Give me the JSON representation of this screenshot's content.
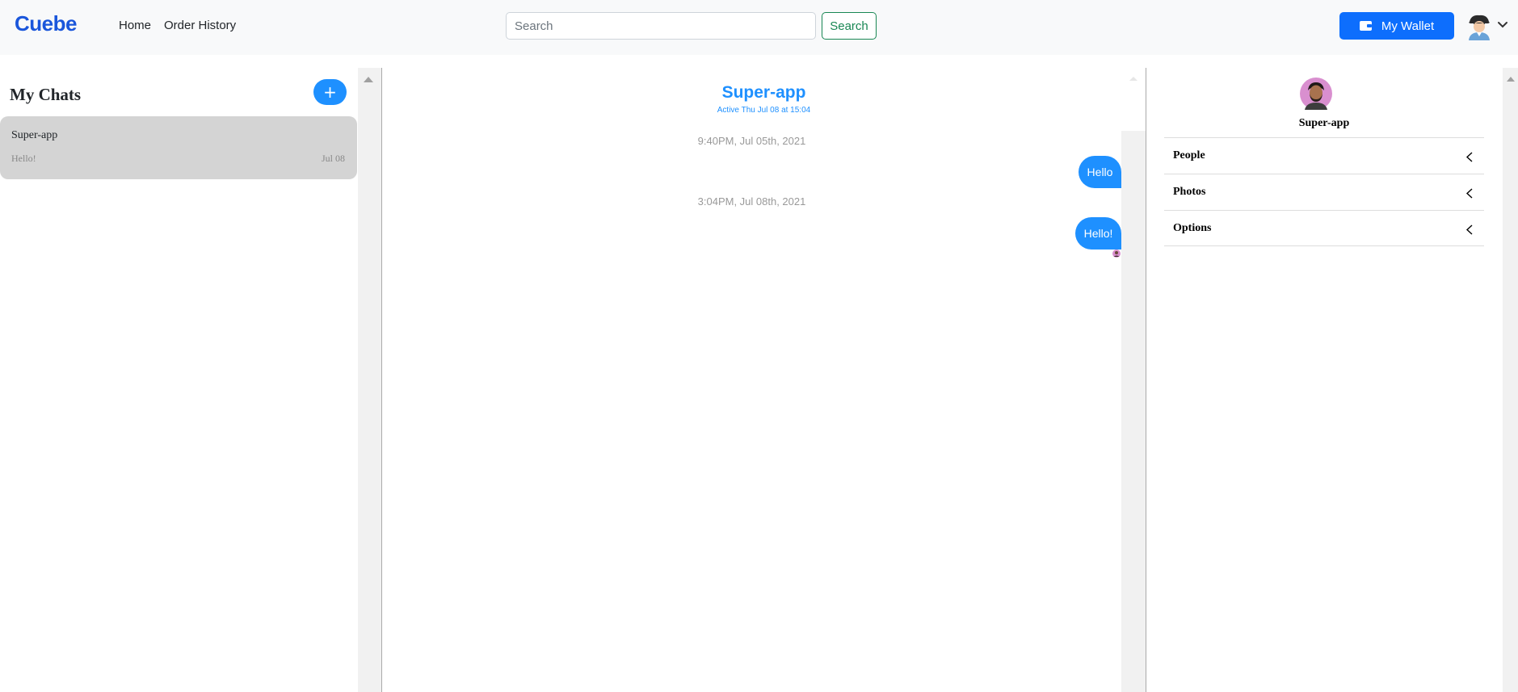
{
  "navbar": {
    "brand": "Cuebe",
    "links": [
      "Home",
      "Order History"
    ],
    "search_placeholder": "Search",
    "search_button": "Search",
    "wallet_button": "My Wallet"
  },
  "sidebar": {
    "title": "My Chats",
    "add_button": "+",
    "chats": [
      {
        "name": "Super-app",
        "preview": "Hello!",
        "date": "Jul 08"
      }
    ]
  },
  "chat": {
    "title": "Super-app",
    "status": "Active Thu Jul 08 at 15:04",
    "messages": [
      {
        "timestamp": "9:40PM, Jul 05th, 2021",
        "text": "Hello"
      },
      {
        "timestamp": "3:04PM, Jul 08th, 2021",
        "text": "Hello!"
      }
    ]
  },
  "details": {
    "name": "Super-app",
    "sections": [
      "People",
      "Photos",
      "Options"
    ]
  },
  "colors": {
    "brand": "#1a56db",
    "accent": "#1e90ff",
    "wallet": "#0d6efd",
    "search_button": "#198754",
    "selected_chat": "#d4d4d4"
  }
}
